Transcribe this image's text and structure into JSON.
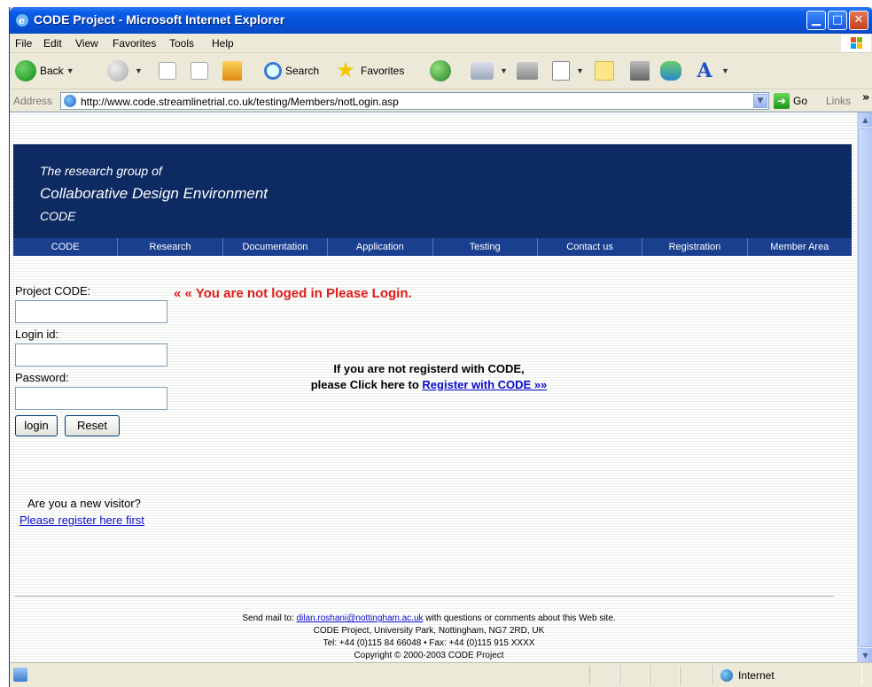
{
  "window": {
    "title": "CODE Project - Microsoft Internet Explorer",
    "buttons": {
      "minimize": "▁",
      "maximize": "□",
      "close": "✕"
    }
  },
  "menu": [
    "File",
    "Edit",
    "View",
    "Favorites",
    "Tools",
    "Help"
  ],
  "toolbar": {
    "back_label": "Back",
    "search_label": "Search",
    "favorites_label": "Favorites"
  },
  "address": {
    "label": "Address",
    "url": "http://www.code.streamlinetrial.co.uk/testing/Members/notLogin.asp",
    "go_label": "Go",
    "links_label": "Links",
    "links_chevron": "»"
  },
  "site": {
    "tagline": [
      "The research group of",
      "Collaborative Design Environment",
      "CODE"
    ],
    "nav": [
      "CODE",
      "Research",
      "Documentation",
      "Application",
      "Testing",
      "Contact us",
      "Registration",
      "Member Area"
    ]
  },
  "login": {
    "project_label": "Project CODE:",
    "login_label": "Login id:",
    "password_label": "Password:",
    "project_value": "",
    "login_value": "",
    "password_value": "",
    "login_button": "login",
    "reset_button": "Reset"
  },
  "message": {
    "not_logged": "« « You are not loged in Please Login.",
    "register_line_1": "If you are not registerd with CODE,",
    "register_line_2_prefix": "please Click here to ",
    "register_link": "Register with CODE »»",
    "new_visitor": "Are you a new visitor?",
    "register_first": "Please register here first"
  },
  "footer": {
    "send_mail_prefix": "Send mail to: ",
    "email": "dilan.roshani@nottingham.ac.uk",
    "send_mail_suffix": " with questions or comments about this Web site.",
    "address": "CODE Project, University Park, Nottingham, NG7 2RD, UK",
    "contact": "Tel: +44 (0)115 84 66048 • Fax: +44 (0)115 915 XXXX",
    "copyright": "Copyright © 2000-2003 CODE Project"
  },
  "status": {
    "zone": "Internet"
  },
  "colors": {
    "title_bar": "#0552d8",
    "site_header": "#0d2a63",
    "nav": "#1a3f8f",
    "error_text": "#e21b1b",
    "link": "#0b0bcc"
  },
  "icons": [
    "ie-icon",
    "back-icon",
    "forward-icon",
    "stop-icon",
    "refresh-icon",
    "home-icon",
    "search-icon",
    "favorites-star-icon",
    "history-icon",
    "mail-icon",
    "print-icon",
    "edit-icon",
    "note-icon",
    "research-icon",
    "messenger-icon",
    "font-icon",
    "go-arrow-icon",
    "windows-logo-icon",
    "internet-zone-icon"
  ]
}
